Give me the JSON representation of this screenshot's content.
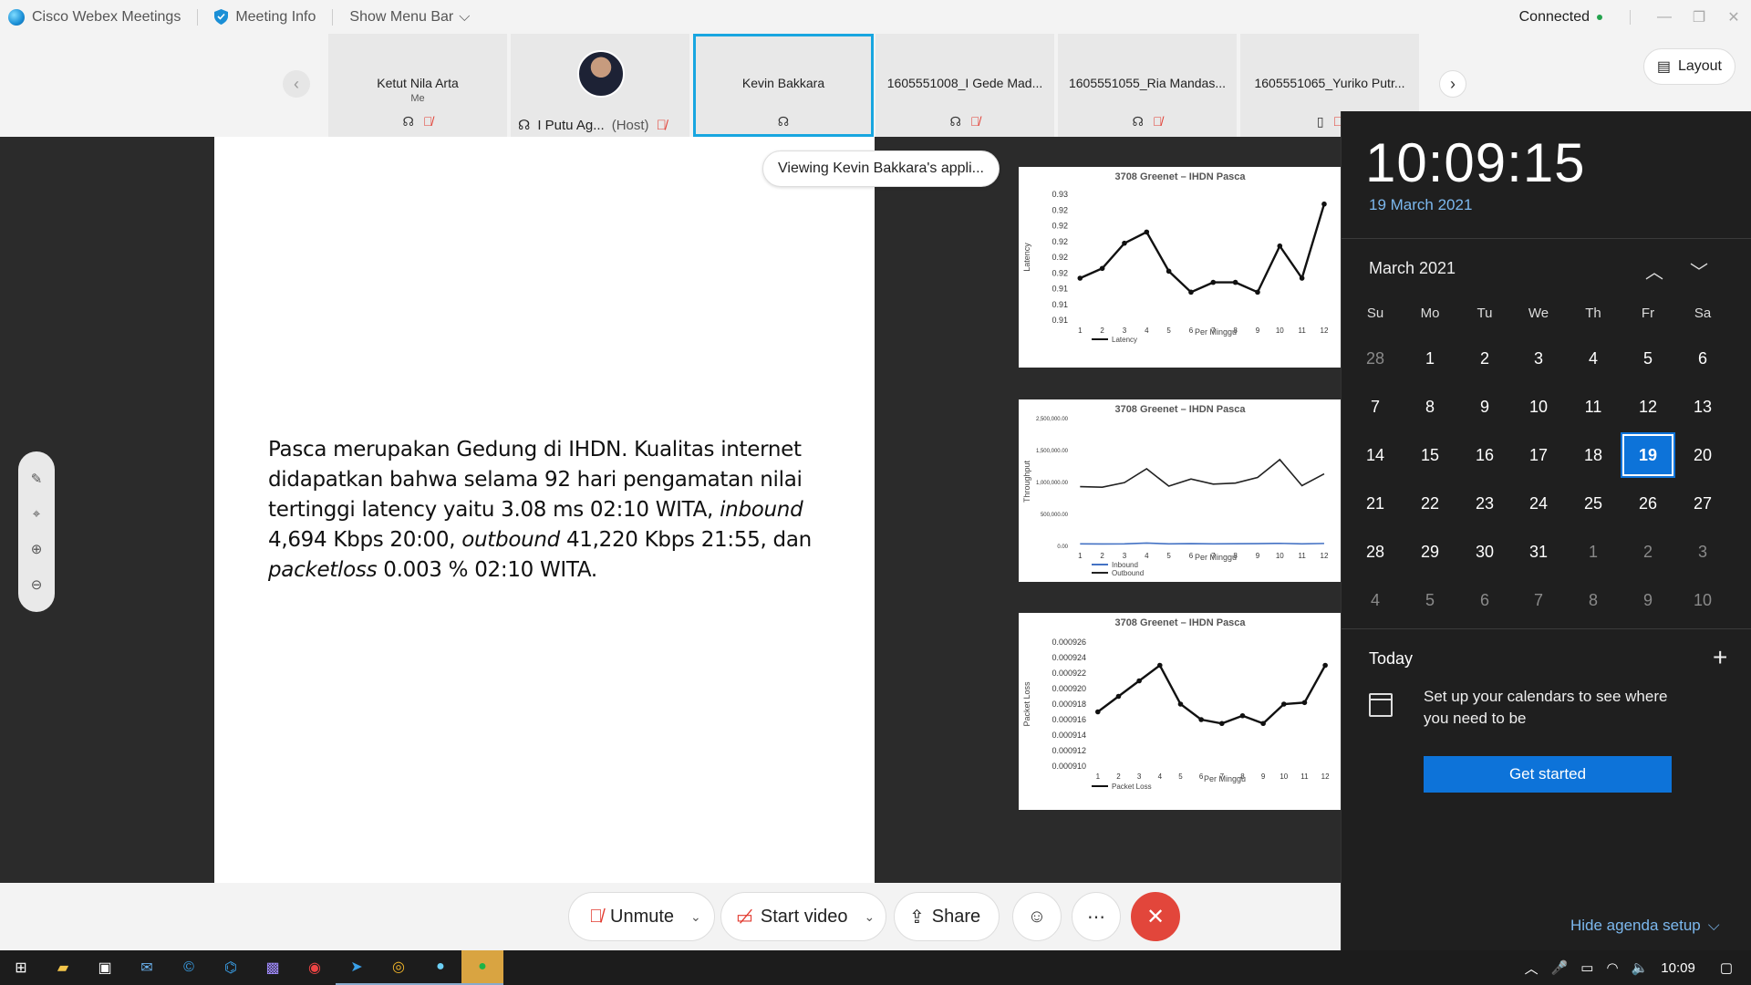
{
  "titlebar": {
    "app_name": "Cisco Webex Meetings",
    "meeting_info": "Meeting Info",
    "show_menu_bar": "Show Menu Bar",
    "status": "Connected"
  },
  "participants": [
    {
      "name": "Ketut Nila Arta",
      "sub": "Me"
    },
    {
      "name": "I Putu Ag...",
      "sub": "(Host)"
    },
    {
      "name": "Kevin Bakkara",
      "sub": ""
    },
    {
      "name": "1605551008_I Gede Mad...",
      "sub": ""
    },
    {
      "name": "1605551055_Ria Mandas...",
      "sub": ""
    },
    {
      "name": "1605551065_Yuriko Putr...",
      "sub": ""
    }
  ],
  "layout_label": "Layout",
  "viewing_label": "Viewing Kevin Bakkara's appli...",
  "slide": {
    "line1": "Pasca merupakan Gedung di IHDN. Kualitas internet",
    "line2": "didapatkan bahwa selama 92 hari pengamatan nilai",
    "line3a": "tertinggi latency  yaitu 3.08 ms 02:10 WITA, ",
    "line3b": "inbound",
    "line4a": "4,694 Kbps 20:00, ",
    "line4b": "outbound",
    "line4c": " 41,220 Kbps 21:55, dan",
    "line5a": "packetloss",
    "line5b": " 0.003 % 02:10 WITA."
  },
  "chart_data": [
    {
      "type": "line",
      "title": "3708 Greenet – IHDN Pasca",
      "xlabel": "Per Minggu",
      "ylabel": "Latency",
      "x": [
        1,
        2,
        3,
        4,
        5,
        6,
        7,
        8,
        9,
        10,
        11,
        12
      ],
      "ytick_labels": [
        "0.93",
        "0.92",
        "0.92",
        "0.92",
        "0.92",
        "0.92",
        "0.91",
        "0.91",
        "0.91"
      ],
      "series": [
        {
          "name": "Latency",
          "values": [
            0.9175,
            0.9182,
            0.92,
            0.9208,
            0.918,
            0.9165,
            0.9172,
            0.9172,
            0.9165,
            0.9198,
            0.9175,
            0.9228
          ]
        }
      ]
    },
    {
      "type": "line",
      "title": "3708 Greenet – IHDN Pasca",
      "xlabel": "Per Minggu",
      "ylabel": "Throughput",
      "x": [
        1,
        2,
        3,
        4,
        5,
        6,
        7,
        8,
        9,
        10,
        11,
        12
      ],
      "ytick_labels": [
        "2,500,000.00",
        "1,500,000.00",
        "1,000,000.00",
        "500,000.00",
        "0.00"
      ],
      "series": [
        {
          "name": "Inbound",
          "values": [
            30000,
            28000,
            31000,
            45000,
            30000,
            35000,
            30000,
            33000,
            35000,
            40000,
            30000,
            38000
          ]
        },
        {
          "name": "Outbound",
          "values": [
            1150000,
            1140000,
            1230000,
            1500000,
            1160000,
            1300000,
            1200000,
            1220000,
            1330000,
            1680000,
            1170000,
            1400000
          ]
        }
      ]
    },
    {
      "type": "line",
      "title": "3708 Greenet – IHDN Pasca",
      "xlabel": "Per Minggu",
      "ylabel": "Packet Loss",
      "x": [
        1,
        2,
        3,
        4,
        5,
        6,
        7,
        8,
        9,
        10,
        11,
        12
      ],
      "ytick_labels": [
        "0.000926",
        "0.000924",
        "0.000922",
        "0.000920",
        "0.000918",
        "0.000916",
        "0.000914",
        "0.000912",
        "0.000910"
      ],
      "series": [
        {
          "name": "Packet Loss",
          "values": [
            0.000917,
            0.000919,
            0.000921,
            0.000923,
            0.000918,
            0.000916,
            0.0009155,
            0.0009165,
            0.0009155,
            0.000918,
            0.0009182,
            0.000923
          ]
        }
      ]
    }
  ],
  "controls": {
    "unmute": "Unmute",
    "start_video": "Start video",
    "share": "Share"
  },
  "calendar": {
    "time": "10:09:15",
    "date": "19 March 2021",
    "month": "March 2021",
    "dow": [
      "Su",
      "Mo",
      "Tu",
      "We",
      "Th",
      "Fr",
      "Sa"
    ],
    "weeks": [
      [
        "28",
        "1",
        "2",
        "3",
        "4",
        "5",
        "6"
      ],
      [
        "7",
        "8",
        "9",
        "10",
        "11",
        "12",
        "13"
      ],
      [
        "14",
        "15",
        "16",
        "17",
        "18",
        "19",
        "20"
      ],
      [
        "21",
        "22",
        "23",
        "24",
        "25",
        "26",
        "27"
      ],
      [
        "28",
        "29",
        "30",
        "31",
        "1",
        "2",
        "3"
      ],
      [
        "4",
        "5",
        "6",
        "7",
        "8",
        "9",
        "10"
      ]
    ],
    "today_label": "Today",
    "agenda_text": "Set up your calendars to see where you need to be",
    "get_started": "Get started",
    "hide_agenda": "Hide agenda setup"
  },
  "taskbar": {
    "clock": "10:09"
  }
}
